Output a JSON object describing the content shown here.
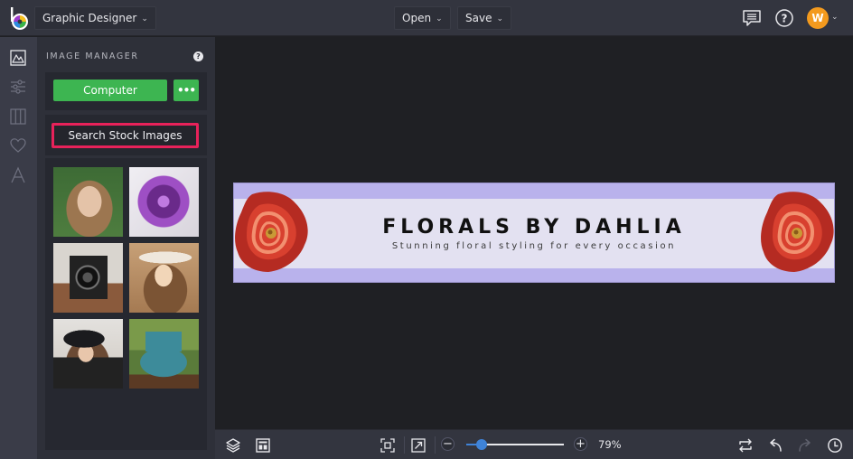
{
  "topbar": {
    "app_mode": "Graphic Designer",
    "open_label": "Open",
    "save_label": "Save",
    "user_initial": "W",
    "avatar_color": "#f39a1e",
    "icons": [
      "comments-icon",
      "help-icon"
    ]
  },
  "rail": {
    "items": [
      "image-manager",
      "adjustments",
      "layouts",
      "favorites",
      "text"
    ],
    "active": "image-manager"
  },
  "panel": {
    "title": "IMAGE MANAGER",
    "help": "?",
    "computer_label": "Computer",
    "more_label": "•••",
    "search_label": "Search Stock Images",
    "highlight_color": "#e8225a",
    "accent_green": "#3db551",
    "thumbnails": [
      {
        "subject": "smiling woman portrait",
        "colors": [
          "#3d6b35",
          "#b08a64",
          "#e4c3a8"
        ]
      },
      {
        "subject": "purple succulent flower",
        "colors": [
          "#e9e6ec",
          "#6a2a8a",
          "#9e4fc4"
        ]
      },
      {
        "subject": "vintage camera",
        "colors": [
          "#d9d5cf",
          "#222222",
          "#8a5a3c"
        ]
      },
      {
        "subject": "woman in sun hat",
        "colors": [
          "#c7a077",
          "#7b5434",
          "#f2d6b8"
        ]
      },
      {
        "subject": "woman in black hat",
        "colors": [
          "#e3e1de",
          "#1b1b1e",
          "#6b4a34"
        ]
      },
      {
        "subject": "vintage blue truck",
        "colors": [
          "#5a7b3a",
          "#3d8b9a",
          "#5b3a24"
        ]
      }
    ]
  },
  "canvas": {
    "banner": {
      "title": "FLORALS BY DAHLIA",
      "subtitle": "Stunning floral styling for every occasion",
      "outer_color": "#b9b2ec",
      "inner_color": "#e3e1f1"
    }
  },
  "bottombar": {
    "zoom_percent": 79,
    "zoom_label": "79%",
    "zoom_slider_fraction": 0.16,
    "minus": "−",
    "plus": "+"
  }
}
